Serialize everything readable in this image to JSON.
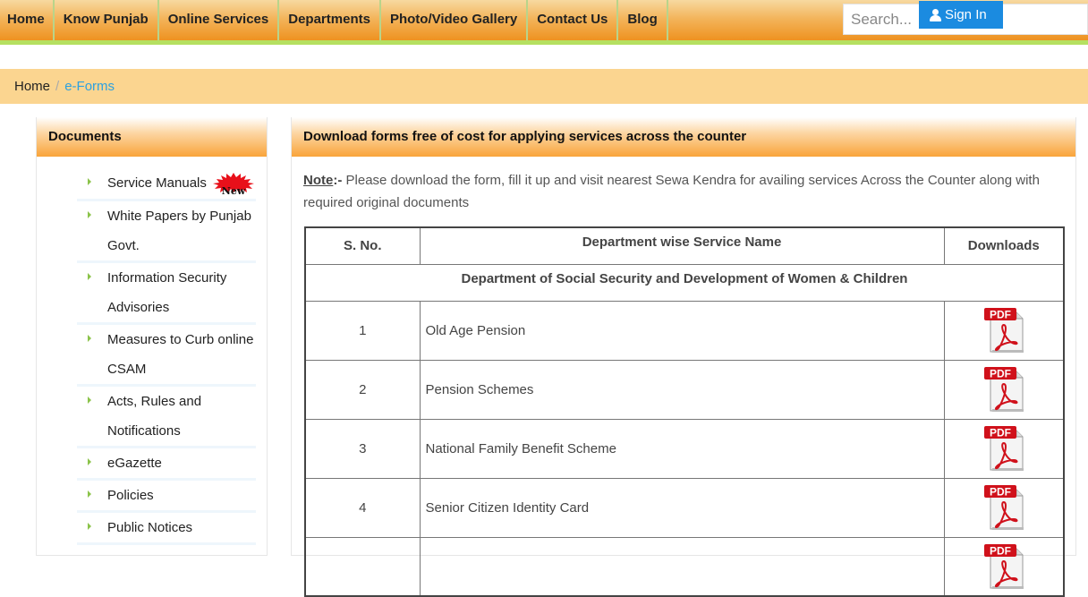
{
  "nav": {
    "items": [
      "Home",
      "Know Punjab",
      "Online Services",
      "Departments",
      "Photo/Video Gallery",
      "Contact Us",
      "Blog"
    ],
    "search_placeholder": "Search...",
    "signin_label": "Sign In",
    "signin_icon": "user-icon"
  },
  "breadcrumb": {
    "home": "Home",
    "separator": "/",
    "current": "e-Forms"
  },
  "sidebar": {
    "title": "Documents",
    "items": [
      {
        "label": "Service Manuals",
        "badge": "New"
      },
      {
        "label": "White Papers by Punjab Govt."
      },
      {
        "label": "Information Security Advisories"
      },
      {
        "label": "Measures to Curb online CSAM"
      },
      {
        "label": "Acts, Rules and Notifications"
      },
      {
        "label": "eGazette"
      },
      {
        "label": "Policies"
      },
      {
        "label": "Public Notices"
      }
    ]
  },
  "main": {
    "title": "Download forms free of cost for applying services across the counter",
    "note_label": "Note",
    "note_sep": ":-",
    "note_text": " Please download the form, fill it up and visit nearest Sewa Kendra for availing services Across the Counter along with required original documents",
    "table": {
      "headers": [
        "S. No.",
        "Department wise Service Name",
        "Downloads"
      ],
      "department": "Department of Social Security and Development of Women & Children",
      "rows": [
        {
          "sno": "1",
          "name": "Old Age Pension",
          "download_icon": "pdf-icon"
        },
        {
          "sno": "2",
          "name": "Pension Schemes",
          "download_icon": "pdf-icon"
        },
        {
          "sno": "3",
          "name": "National Family Benefit Scheme",
          "download_icon": "pdf-icon"
        },
        {
          "sno": "4",
          "name": "Senior Citizen Identity Card",
          "download_icon": "pdf-icon"
        },
        {
          "sno": "",
          "name": "",
          "download_icon": "pdf-icon"
        }
      ]
    }
  },
  "colors": {
    "nav_gradient_bottom": "#ee9220",
    "nav_border": "#b5e061",
    "breadcrumb_bg": "#fbd590",
    "link": "#2da1e0",
    "signin_bg": "#1b8be0",
    "pdf_red": "#d0111b"
  }
}
